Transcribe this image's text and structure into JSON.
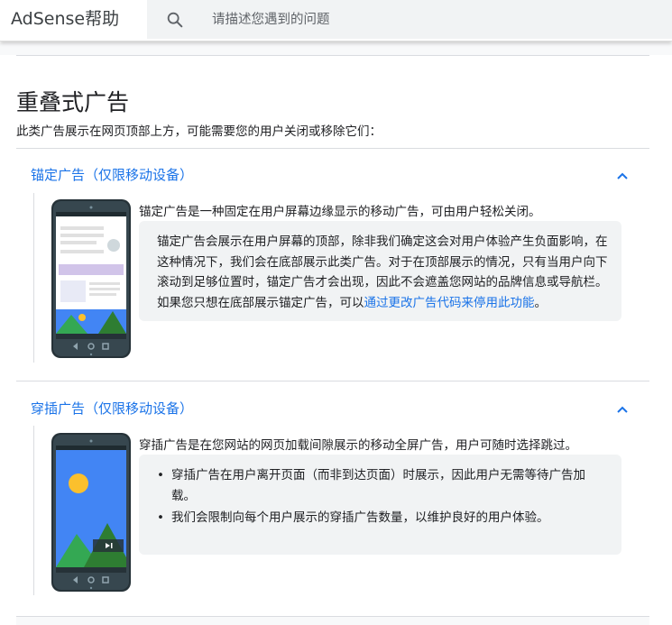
{
  "header": {
    "brand": "AdSense帮助",
    "search_placeholder": "请描述您遇到的问题",
    "search_value": ""
  },
  "page": {
    "title": "重叠式广告",
    "intro": "此类广告展示在网页顶部上方，可能需要您的用户关闭或移除它们："
  },
  "sections": [
    {
      "title": "锚定广告（仅限移动设备）",
      "lead": "锚定广告是一种固定在用户屏幕边缘显示的移动广告，可由用户轻松关闭。",
      "note_text": "锚定广告会展示在用户屏幕的顶部，除非我们确定这会对用户体验产生负面影响，在这种情况下，我们会在底部展示此类广告。对于在顶部展示的情况，只有当用户向下滚动到足够位置时，锚定广告才会出现，因此不会遮盖您网站的品牌信息或导航栏。如果您只想在底部展示锚定广告，可以",
      "note_link": "通过更改广告代码来停用此功能",
      "note_end": "。"
    },
    {
      "title": "穿插广告（仅限移动设备）",
      "lead": "穿插广告是在您网站的网页加载间隙展示的移动全屏广告，用户可随时选择跳过。",
      "bullets": [
        "穿插广告在用户离开页面（而非到达页面）时展示，因此用户无需等待广告加载。",
        "我们会限制向每个用户展示的穿插广告数量，以维护良好的用户体验。"
      ]
    }
  ],
  "colors": {
    "link": "#1a73e8",
    "note_bg": "#f1f3f4",
    "divider": "#dadce0"
  },
  "icons": [
    "search-icon",
    "chevron-up-icon"
  ]
}
